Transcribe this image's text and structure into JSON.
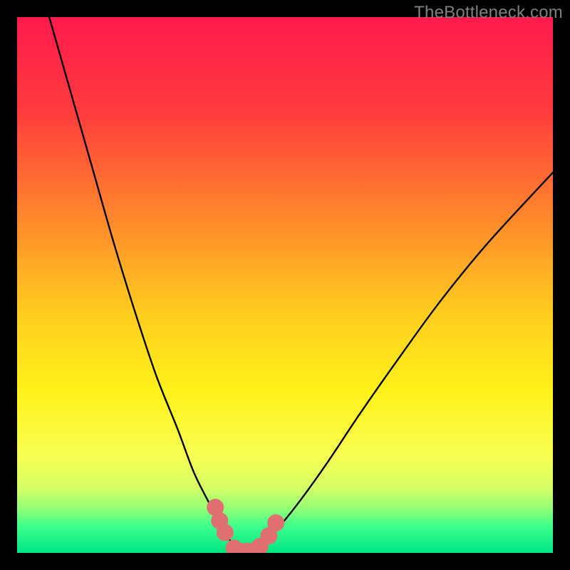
{
  "watermark": "TheBottleneck.com",
  "chart_data": {
    "type": "line",
    "title": "",
    "xlabel": "",
    "ylabel": "",
    "xlim": [
      0,
      100
    ],
    "ylim": [
      0,
      100
    ],
    "series": [
      {
        "name": "curve-left",
        "x": [
          6,
          10,
          14,
          18,
          22,
          26,
          30,
          33,
          36,
          38,
          40,
          41.5
        ],
        "y": [
          100,
          86,
          72,
          58,
          45,
          33,
          23,
          15,
          9,
          5,
          2,
          0
        ]
      },
      {
        "name": "curve-right",
        "x": [
          44,
          46,
          49,
          53,
          58,
          64,
          71,
          79,
          88,
          100
        ],
        "y": [
          0,
          2,
          5,
          10,
          17,
          26,
          36,
          47,
          58,
          71
        ]
      }
    ],
    "markers": {
      "name": "bottleneck-points",
      "color": "#e07070",
      "points": [
        {
          "x": 37.0,
          "y": 8.5,
          "r": 1.6
        },
        {
          "x": 37.8,
          "y": 6.0,
          "r": 1.6
        },
        {
          "x": 38.8,
          "y": 3.8,
          "r": 1.6
        },
        {
          "x": 40.5,
          "y": 0.9,
          "r": 1.6
        },
        {
          "x": 41.6,
          "y": 0.5,
          "r": 1.4
        },
        {
          "x": 42.7,
          "y": 0.5,
          "r": 1.4
        },
        {
          "x": 43.9,
          "y": 0.5,
          "r": 1.4
        },
        {
          "x": 45.3,
          "y": 1.2,
          "r": 1.6
        },
        {
          "x": 47.0,
          "y": 3.2,
          "r": 1.6
        },
        {
          "x": 48.3,
          "y": 5.6,
          "r": 1.6
        }
      ]
    },
    "gradient_stops": [
      {
        "offset": 0,
        "color": "#ff1a4d"
      },
      {
        "offset": 18,
        "color": "#ff3d3d"
      },
      {
        "offset": 38,
        "color": "#ff8a2b"
      },
      {
        "offset": 55,
        "color": "#ffcc1f"
      },
      {
        "offset": 70,
        "color": "#fff21a"
      },
      {
        "offset": 82,
        "color": "#f7ff52"
      },
      {
        "offset": 88,
        "color": "#d3ff66"
      },
      {
        "offset": 92,
        "color": "#8cff78"
      },
      {
        "offset": 95,
        "color": "#3dff8c"
      },
      {
        "offset": 100,
        "color": "#00e585"
      }
    ]
  }
}
